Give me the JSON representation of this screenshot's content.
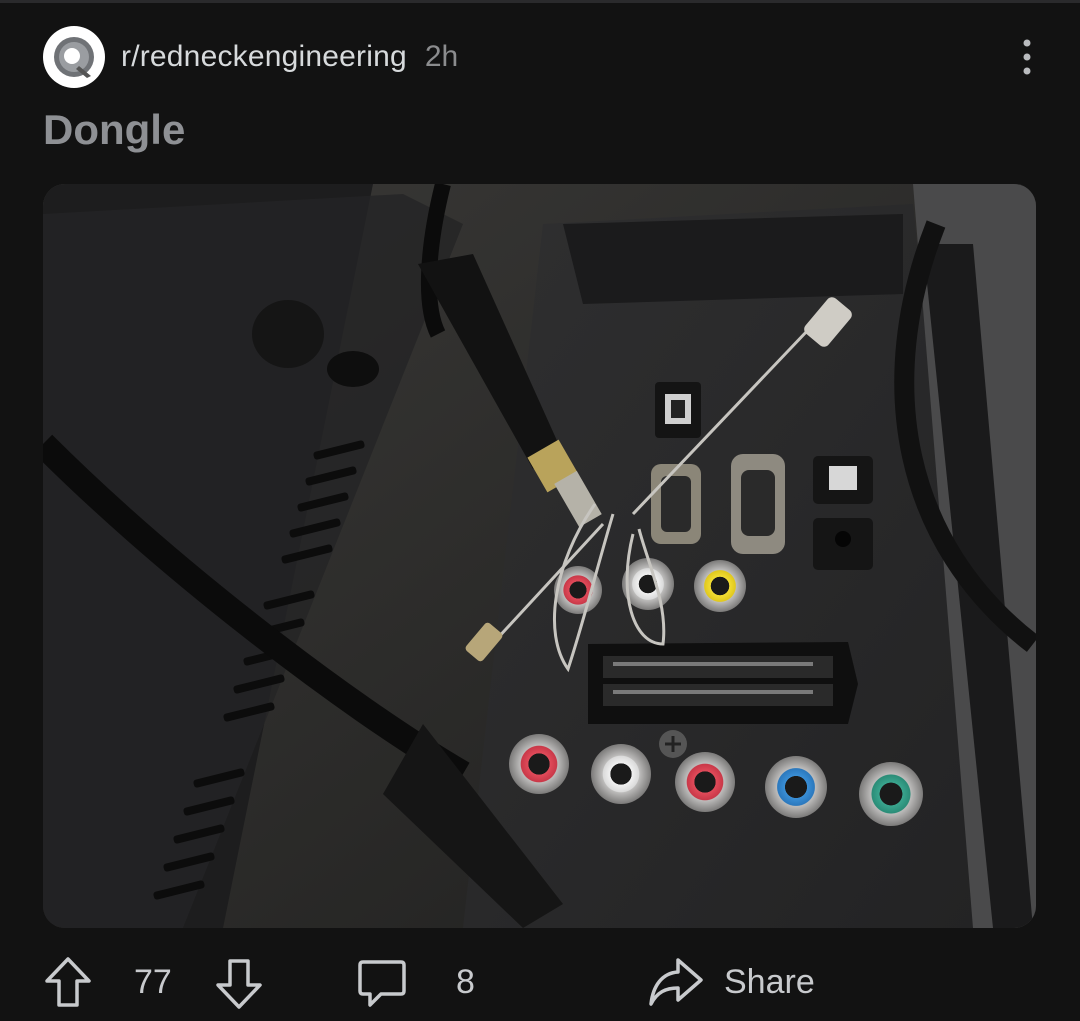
{
  "post": {
    "subreddit": "r/redneckengineering",
    "age": "2h",
    "title": "Dongle"
  },
  "actions": {
    "votes": "77",
    "comments": "8",
    "share_label": "Share"
  },
  "icons": {
    "avatar": "duct-tape-icon",
    "more": "vertical-dots-icon",
    "upvote": "arrow-up-icon",
    "downvote": "arrow-down-icon",
    "comments": "comment-bubble-icon",
    "share": "share-arrow-icon"
  },
  "colors": {
    "background": "#121212",
    "text": "#d7dadc",
    "muted": "#8b8c8e"
  }
}
